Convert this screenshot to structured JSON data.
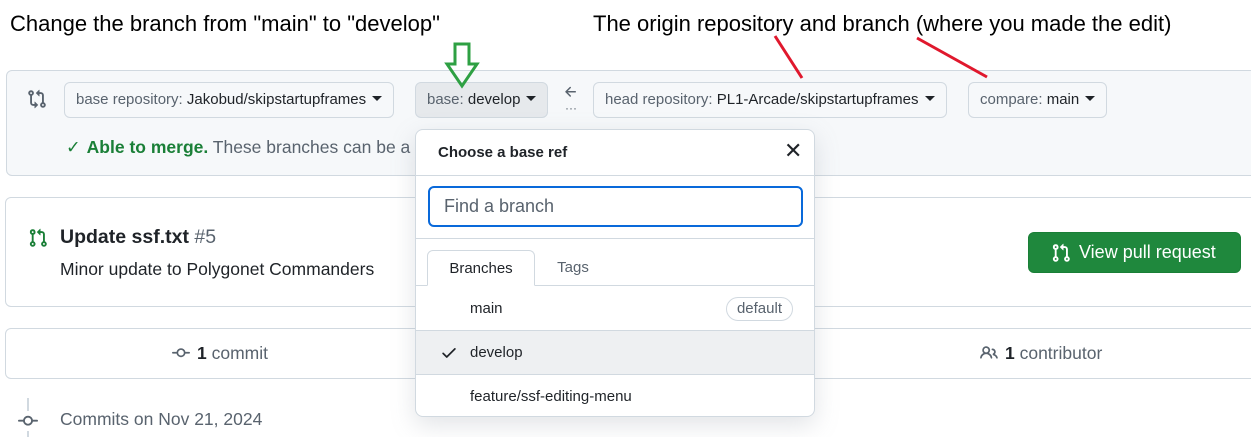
{
  "annotations": {
    "left_text": "Change the branch from \"main\" to \"develop\"",
    "right_text": "The origin repository and branch (where you made the edit)"
  },
  "compare": {
    "base_repo_label": "base repository: ",
    "base_repo_value": "Jakobud/skipstartupframes",
    "base_label": "base: ",
    "base_value": "develop",
    "head_repo_label": "head repository: ",
    "head_repo_value": "PL1-Arcade/skipstartupframes",
    "compare_label": "compare: ",
    "compare_value": "main",
    "merge_ok": "Able to merge.",
    "merge_text": " These branches can be a"
  },
  "pr": {
    "title": "Update ssf.txt",
    "number": "#5",
    "description": "Minor update to Polygonet Commanders",
    "view_button": "View pull request"
  },
  "stats": {
    "commits_count": "1",
    "commits_label": " commit",
    "contributors_count": "1",
    "contributors_label": " contributor"
  },
  "timeline": {
    "commits_on": "Commits on Nov 21, 2024"
  },
  "dropdown": {
    "title": "Choose a base ref",
    "close_symbol": "✕",
    "search_placeholder": "Find a branch",
    "tabs": [
      "Branches",
      "Tags"
    ],
    "branches": [
      {
        "name": "main",
        "badge": "default",
        "selected": false
      },
      {
        "name": "develop",
        "badge": "",
        "selected": true
      },
      {
        "name": "feature/ssf-editing-menu",
        "badge": "",
        "selected": false
      }
    ]
  },
  "colors": {
    "accent_green": "#1f883d",
    "annotation_green": "#2ea043",
    "annotation_red": "#e0182d",
    "focus_blue": "#0969da"
  },
  "icons": [
    "git-compare-icon",
    "caret-down-icon",
    "arrow-left-icon",
    "check-icon",
    "git-pull-request-icon",
    "git-commit-icon",
    "people-icon",
    "close-icon"
  ]
}
